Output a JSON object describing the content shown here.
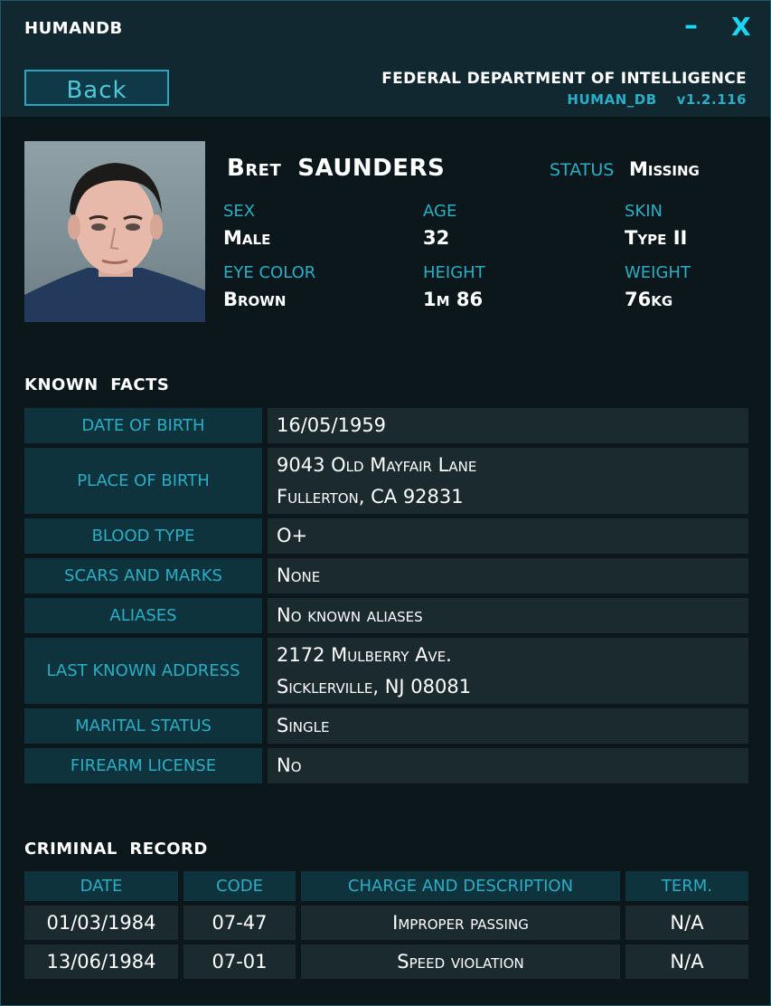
{
  "window": {
    "title": "HUMANDB",
    "minimize_glyph": "–",
    "close_glyph": "X"
  },
  "header": {
    "back_label": "Back",
    "agency": "FEDERAL DEPARTMENT OF INTELLIGENCE",
    "db_name": "HUMAN_DB",
    "version": "v1.2.116"
  },
  "profile": {
    "first_name": "Bret",
    "last_name": "SAUNDERS",
    "status_label": "STATUS",
    "status_value": "Missing",
    "attributes": [
      {
        "label": "SEX",
        "value": "Male"
      },
      {
        "label": "AGE",
        "value": "32"
      },
      {
        "label": "SKIN",
        "value": "Type II"
      },
      {
        "label": "EYE COLOR",
        "value": "Brown"
      },
      {
        "label": "HEIGHT",
        "value": "1m 86"
      },
      {
        "label": "WEIGHT",
        "value": "76kg"
      }
    ]
  },
  "known_facts": {
    "title": "KNOWN  FACTS",
    "rows": [
      {
        "label": "DATE OF BIRTH",
        "lines": [
          "16/05/1959"
        ]
      },
      {
        "label": "PLACE OF BIRTH",
        "lines": [
          "9043 Old Mayfair Lane",
          "Fullerton, CA 92831"
        ]
      },
      {
        "label": "BLOOD TYPE",
        "lines": [
          "O+"
        ]
      },
      {
        "label": "SCARS AND MARKS",
        "lines": [
          "None"
        ]
      },
      {
        "label": "ALIASES",
        "lines": [
          "No known aliases"
        ]
      },
      {
        "label": "LAST KNOWN ADDRESS",
        "lines": [
          "2172 Mulberry Ave.",
          "Sicklerville, NJ 08081"
        ]
      },
      {
        "label": "MARITAL STATUS",
        "lines": [
          "Single"
        ]
      },
      {
        "label": "FIREARM LICENSE",
        "lines": [
          "No"
        ]
      }
    ]
  },
  "criminal_record": {
    "title": "CRIMINAL  RECORD",
    "headers": [
      "DATE",
      "CODE",
      "CHARGE AND DESCRIPTION",
      "TERM."
    ],
    "rows": [
      [
        "01/03/1984",
        "07-47",
        "Improper passing",
        "N/A"
      ],
      [
        "13/06/1984",
        "07-01",
        "Speed violation",
        "N/A"
      ]
    ]
  },
  "colors": {
    "accent": "#2aaec5",
    "title_icons": "#19d6f2",
    "background": "#0b171b",
    "label_cell": "#0f333c",
    "value_cell": "#1a2a2f"
  }
}
